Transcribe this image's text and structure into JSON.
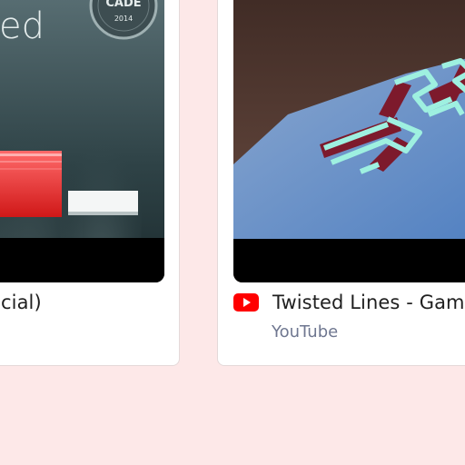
{
  "cards": [
    {
      "title": "cial)",
      "thumbnail_text": "ed",
      "badge_line1": "CADE",
      "badge_line2": "2014"
    },
    {
      "title": "Twisted Lines - Game",
      "source": "YouTube",
      "source_icon": "youtube-icon"
    }
  ],
  "colors": {
    "page_background": "#fde8e8",
    "card_background": "#ffffff",
    "youtube_red": "#ff0000",
    "title_text": "#1f1f1f",
    "source_text": "#6f7790"
  }
}
